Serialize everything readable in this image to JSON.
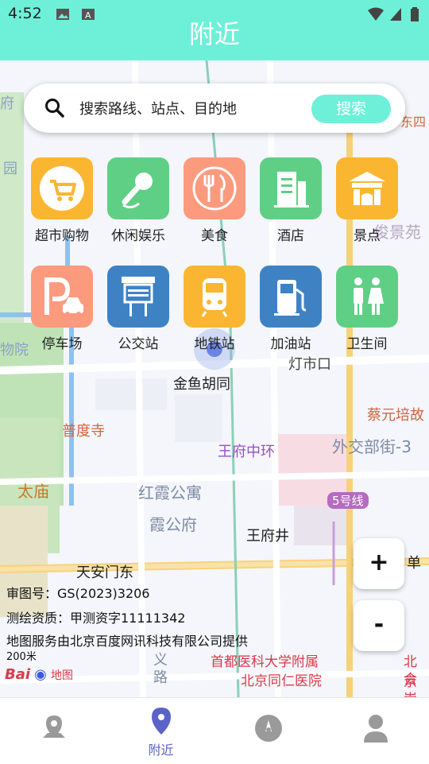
{
  "status_bar": {
    "time": "4:52"
  },
  "app_bar": {
    "title": "附近"
  },
  "search": {
    "placeholder": "搜索路线、站点、目的地",
    "button_label": "搜索"
  },
  "categories": [
    {
      "label": "超市购物",
      "icon": "shopping-cart-icon",
      "color": "#fbb631"
    },
    {
      "label": "休闲娱乐",
      "icon": "microphone-icon",
      "color": "#5fcf85"
    },
    {
      "label": "美食",
      "icon": "fork-knife-icon",
      "color": "#fc9a7e"
    },
    {
      "label": "酒店",
      "icon": "hotel-building-icon",
      "color": "#5fcf85"
    },
    {
      "label": "景点",
      "icon": "gate-icon",
      "color": "#fbb631"
    },
    {
      "label": "停车场",
      "icon": "parking-icon",
      "color": "#fc9a7e"
    },
    {
      "label": "公交站",
      "icon": "bus-stop-icon",
      "color": "#3f82c4"
    },
    {
      "label": "地铁站",
      "icon": "subway-icon",
      "color": "#fbb631"
    },
    {
      "label": "加油站",
      "icon": "gas-pump-icon",
      "color": "#3f82c4"
    },
    {
      "label": "卫生间",
      "icon": "restroom-icon",
      "color": "#5fcf85"
    }
  ],
  "map_labels": {
    "jinyu": "金鱼胡同",
    "dengshikou": "灯市口",
    "pudusi": "普度寺",
    "caiyuan": "蔡元培故",
    "waijiaobu": "外交部街-3",
    "wangfuzhonghuan": "王府中环",
    "hongxia": "红霞公寓",
    "xiagongfu": "霞公府",
    "line5": "5号线",
    "wangfujing": "王府井",
    "taimiao": "太庙",
    "tiananmendong": "天安门东",
    "dan": "单",
    "shoudu": "首都医科大学附属",
    "tongren": "北京同仁医院",
    "yi": "义",
    "lu": "路",
    "beijing": "北京",
    "huichong": "会崇",
    "yuan": "园",
    "wuyuan": "物院",
    "yijingyuan": "俊景苑",
    "dongsi": "东四",
    "fu": "府",
    "baidu": "Bai",
    "baidu2": "地图"
  },
  "map_info": {
    "approval": "审图号：GS(2023)3206",
    "qualification": "测绘资质：甲测资字11111342",
    "provider": "地图服务由北京百度网讯科技有限公司提供",
    "scale": "200米"
  },
  "zoom": {
    "in": "+",
    "out": "-"
  },
  "tabs": [
    {
      "label": "",
      "icon": "map-pin-icon"
    },
    {
      "label": "附近",
      "icon": "location-icon"
    },
    {
      "label": "",
      "icon": "compass-icon"
    },
    {
      "label": "",
      "icon": "user-icon"
    }
  ]
}
